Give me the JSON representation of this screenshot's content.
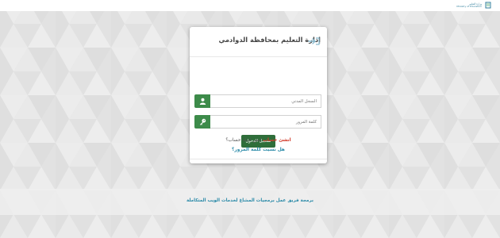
{
  "header": {
    "logo_lines": [
      "وزارة التعليم",
      "Ministry of Education"
    ]
  },
  "login": {
    "title": "إدارة التعليم بمحافظة الدوادمي",
    "username_placeholder": "السجل المدني",
    "password_placeholder": "كلمة المرور",
    "submit_label": "تسجيل الدخول",
    "no_account_text": "ليس لديك حساب؟",
    "create_account_link": "انشئ حساب",
    "forgot_password_link": "هل نسيت كلمة المرور؟"
  },
  "footer": {
    "credits": "برمجة فريق عمل برمجيات المشاغ لخدمات الويب المتكاملة"
  },
  "colors": {
    "accent_green": "#3d8b4a",
    "button_green": "#2f6e3a",
    "link_red": "#d23b2b",
    "link_teal": "#2a8aa8"
  },
  "icons": {
    "user_field": "user-icon",
    "password_field": "key-icon",
    "title": "login-arrow-icon"
  }
}
